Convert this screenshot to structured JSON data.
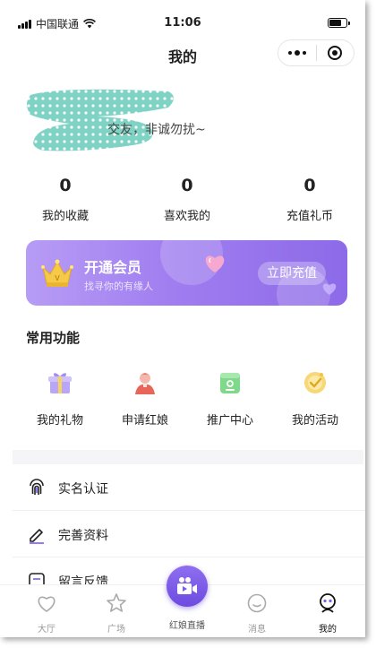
{
  "status_bar": {
    "carrier": "中国联通",
    "time": "11:06"
  },
  "nav": {
    "title": "我的"
  },
  "profile": {
    "bio": "交友，非诚勿扰~"
  },
  "stats": [
    {
      "value": "0",
      "label": "我的收藏"
    },
    {
      "value": "0",
      "label": "喜欢我的"
    },
    {
      "value": "0",
      "label": "充值礼币"
    }
  ],
  "vip": {
    "title": "开通会员",
    "subtitle": "找寻你的有缘人",
    "button": "立即充值"
  },
  "functions": {
    "title": "常用功能",
    "items": [
      {
        "label": "我的礼物",
        "icon": "gift-icon"
      },
      {
        "label": "申请红娘",
        "icon": "person-icon"
      },
      {
        "label": "推广中心",
        "icon": "promotion-icon"
      },
      {
        "label": "我的活动",
        "icon": "activity-badge-icon"
      }
    ]
  },
  "menu": [
    {
      "label": "实名认证",
      "icon": "fingerprint-icon"
    },
    {
      "label": "完善资料",
      "icon": "edit-icon"
    },
    {
      "label": "留言反馈",
      "icon": "feedback-icon"
    }
  ],
  "tabbar": [
    {
      "label": "大厅",
      "icon": "heart-icon"
    },
    {
      "label": "广场",
      "icon": "star-icon"
    },
    {
      "label": "红娘直播",
      "icon": "video-camera-icon"
    },
    {
      "label": "消息",
      "icon": "chat-icon"
    },
    {
      "label": "我的",
      "icon": "user-icon"
    }
  ],
  "colors": {
    "accent": "#8d6ae8",
    "profile_blob": "#7fd3c4"
  }
}
